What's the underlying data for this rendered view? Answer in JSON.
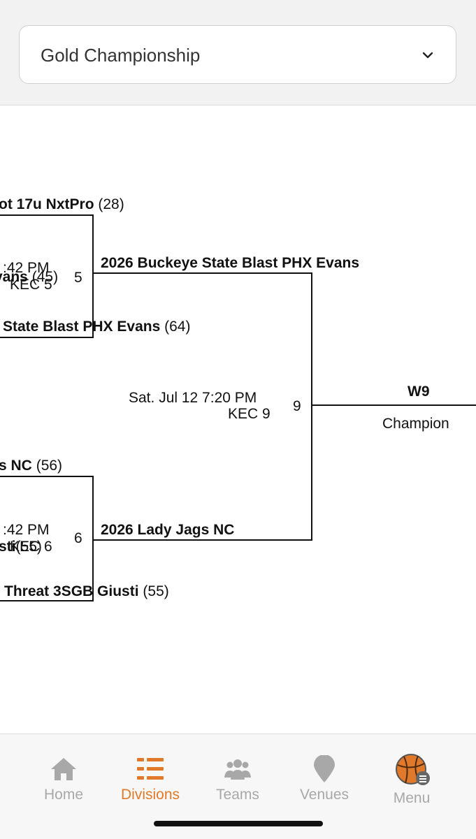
{
  "division_select": {
    "value": "Gold Championship"
  },
  "bracket": {
    "game5": {
      "top_team": "ot 17u NxtPro",
      "top_seed": "(28)",
      "time": ":42 PM",
      "overlay_team": "vans",
      "overlay_seed": "(45)",
      "venue": "KEC 5",
      "number": "5",
      "bottom_team": "State Blast PHX Evans",
      "bottom_seed": "(64)"
    },
    "game6": {
      "top_team": "s NC",
      "top_seed": "(56)",
      "time": ":42 PM",
      "overlay_team": "sti",
      "overlay_seed": "(55)",
      "venue": "KEC 6",
      "number": "6",
      "bottom_team": "Threat 3SGB Giusti",
      "bottom_seed": "(55)"
    },
    "game9": {
      "top_team": "2026 Buckeye State Blast PHX Evans",
      "bottom_team": "2026 Lady Jags NC",
      "time": "Sat. Jul 12 7:20 PM",
      "venue": "KEC 9",
      "number": "9"
    },
    "final": {
      "winner_label": "W9",
      "title": "Champion"
    }
  },
  "bottom_nav": {
    "items": [
      {
        "label": "Home",
        "icon": "home-icon"
      },
      {
        "label": "Divisions",
        "icon": "divisions-icon",
        "active": true
      },
      {
        "label": "Teams",
        "icon": "teams-icon"
      },
      {
        "label": "Venues",
        "icon": "venues-icon"
      },
      {
        "label": "Menu",
        "icon": "menu-icon"
      }
    ]
  },
  "colors": {
    "accent": "#e07a2a",
    "inactive": "#a8a8a8",
    "line": "#111111"
  }
}
